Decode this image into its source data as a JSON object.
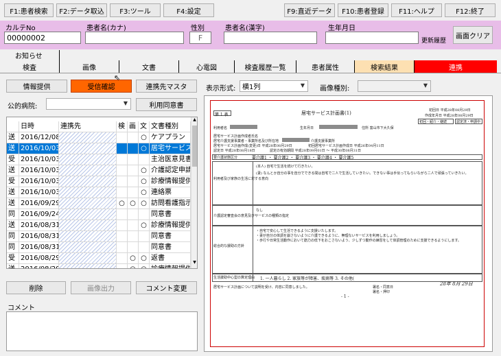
{
  "function_keys": [
    "F1:患者検索",
    "F2:データ取込",
    "F3:ツール",
    "F4:設定",
    "F9:直近データ",
    "F10:患者登録",
    "F11:ヘルプ",
    "F12:終了"
  ],
  "patient": {
    "karte_no_label": "カルテNo",
    "karte_no_value": "00000002",
    "kana_label": "患者名(カナ)",
    "sex_label": "性別",
    "sex_value": "F",
    "kanji_label": "患者名(漢字)",
    "birth_label": "生年月日",
    "history_label": "更新履歴",
    "clear_button": "画面クリア"
  },
  "tabs": {
    "oshirase": "お知らせ",
    "items": [
      "検査",
      "画像",
      "文書",
      "心電図",
      "検査履歴一覧",
      "患者属性",
      "検索結果",
      "連携"
    ]
  },
  "toolbar": {
    "info_button": "情報提供",
    "receive_button": "受信確認",
    "partner_button": "連携先マスタ",
    "public_hospital_label": "公的病院:",
    "consent_button": "利用同意書"
  },
  "view": {
    "display_label": "表示形式:",
    "display_value": "横1列",
    "image_type_label": "画像種別:"
  },
  "grid": {
    "headers": [
      "",
      "日時",
      "連携先",
      "検",
      "画",
      "文",
      "文書種別"
    ],
    "rows": [
      [
        "送",
        "2016/12/08",
        "",
        "",
        "",
        "○",
        "ケアプラン"
      ],
      [
        "送",
        "2016/10/03",
        "",
        "",
        "",
        "○",
        "居宅サービス..."
      ],
      [
        "受",
        "2016/10/03",
        "",
        "",
        "",
        "",
        "主治医意見書"
      ],
      [
        "送",
        "2016/10/03",
        "",
        "",
        "",
        "○",
        "介護認定申請..."
      ],
      [
        "受",
        "2016/10/03",
        "",
        "",
        "",
        "○",
        "診療情報提供書"
      ],
      [
        "送",
        "2016/10/03",
        "",
        "",
        "",
        "○",
        "連絡票"
      ],
      [
        "送",
        "2016/09/29",
        "",
        "○",
        "○",
        "○",
        "訪問看護指示書"
      ],
      [
        "同",
        "2016/09/24",
        "",
        "",
        "",
        "",
        "同意書"
      ],
      [
        "送",
        "2016/08/31",
        "",
        "",
        "",
        "○",
        "診療情報提供書"
      ],
      [
        "同",
        "2016/08/31",
        "",
        "",
        "",
        "",
        "同意書"
      ],
      [
        "同",
        "2016/08/31",
        "",
        "",
        "",
        "",
        "同意書"
      ],
      [
        "受",
        "2016/08/29",
        "",
        "",
        "○",
        "○",
        "返書"
      ],
      [
        "送",
        "2016/08/29",
        "",
        "",
        "○",
        "○",
        "診療情報提供書"
      ]
    ],
    "selected_row": 1
  },
  "actions": {
    "delete_button": "削除",
    "image_output_button": "画像出力",
    "comment_change_button": "コメント変更",
    "comment_label": "コメント"
  },
  "document": {
    "table_no": "第 1 表",
    "title": "居宅サービス計画書(1)",
    "created_date": "初回日 平成28年08月29日",
    "created_date2": "作成年月日 平成28年08月29日",
    "status": "初回・紹介・継続",
    "status2": "認定済・申請中",
    "line_user": "利用者名",
    "line_dob": "生年月日",
    "line_address": "住所 富山市下大久保",
    "line_planner": "居宅サービス計画作成者氏名",
    "line_office": "居宅介護支援事業者・事業所名及び所在地",
    "line_office2": "介護支援事業所",
    "line_plan_date": "居宅サービス計画作成(変更)日 平成28年08月29日",
    "line_first_date": "初回居宅サービス計画作成日 平成26年04月11日",
    "line_cert_date": "認定日 平成28年08月18日",
    "line_valid": "認定の有効期間 平成28年09月01日 ～ 平成30年08月31日",
    "care_level_label": "要介護状態区分",
    "care_levels": "要介護1 ・ 要介護2 ・ 要介護3 ・ 要介護4 ・ 要介護5",
    "section1_label": "利用者及び家族の生活に対する意向",
    "section1_text1": "(本人) 自宅で生活を続けて行きたい。",
    "section1_text2": "(妻) なんとか自分の事を自分でできる間は自宅で二人で生活していきたい。できない事は手伝ってもらいながら二人で頑張っていきたい。",
    "section2_label": "介護認定審査会の意見及びサービスの種類の指定",
    "section2_text": "なし",
    "section3_label": "総合的な援助の方針",
    "section3_text1": "・自宅で安心して生活できるように支援いたします。",
    "section3_text2": "・妻が自分の体調を崩さないように介護できるように、無理ないサービスを利用しましょう。",
    "section3_text3": "・歩行や日常生活動作において筋力の低下をおこさないよう、少しずつ動作の練習をして体調管理のために支援できるようにします。",
    "section4_label": "生活援助中心型の算定理由",
    "section4_text": "1. 一人暮らし   2. 家族等が障害、疾病等   3. その他(",
    "consent_text": "居宅サービス計画について説明を受け、内容に同意しました。",
    "sign_label": "署名・同意日",
    "sign_label2": "署名・押印",
    "sign_date": "28年 8月 29日",
    "page_no": "- 1 -"
  }
}
